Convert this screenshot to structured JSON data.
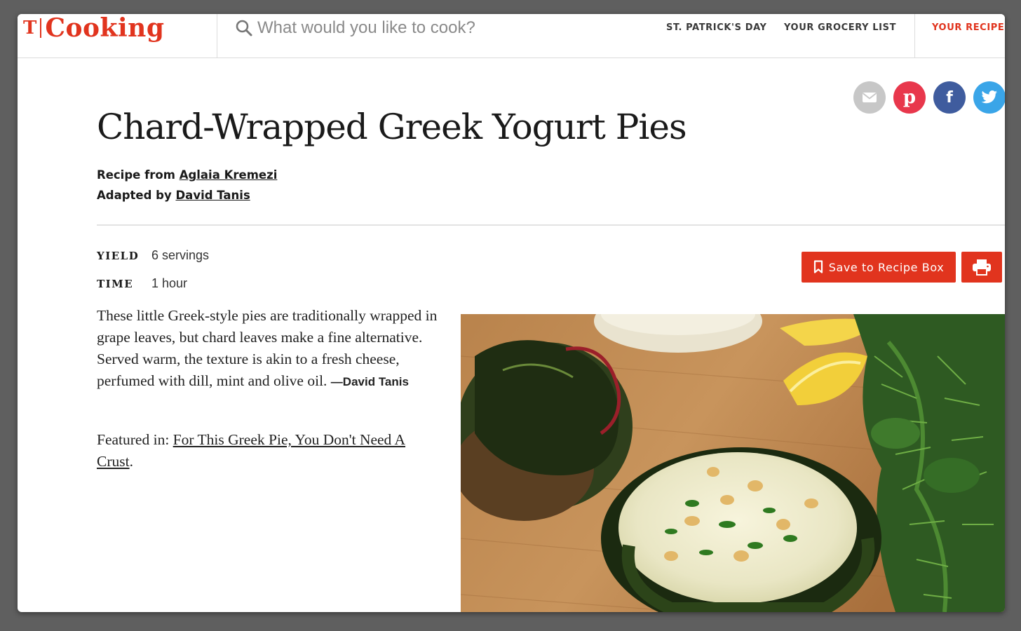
{
  "header": {
    "logo_mark": "T",
    "logo_text": "Cooking",
    "search_placeholder": "What would you like to cook?",
    "nav": [
      "ST. PATRICK'S DAY",
      "YOUR GROCERY LIST",
      "YOUR RECIPE"
    ]
  },
  "share": {
    "email_icon": "envelope-icon",
    "pinterest_icon": "pinterest-icon",
    "pinterest_glyph": "p",
    "facebook_icon": "facebook-icon",
    "facebook_glyph": "f",
    "twitter_icon": "twitter-bird-icon",
    "colors": {
      "email": "#c7c7c7",
      "pinterest": "#e8374c",
      "facebook": "#3f5c9e",
      "twitter": "#3aa5e8"
    }
  },
  "recipe": {
    "title": "Chard-Wrapped Greek Yogurt Pies",
    "recipe_from_label": "Recipe from",
    "recipe_from_name": "Aglaia Kremezi",
    "adapted_by_label": "Adapted by",
    "adapted_by_name": "David Tanis",
    "yield_label": "YIELD",
    "yield_value": "6 servings",
    "time_label": "TIME",
    "time_value": "1 hour",
    "description": "These little Greek-style pies are traditionally wrapped in grape leaves, but chard leaves make a fine alternative. Served warm, the texture is akin to a fresh cheese, perfumed with dill, mint and olive oil.",
    "description_author": "—David Tanis",
    "featured_label": "Featured in:",
    "featured_link": "For This Greek Pie, You Don't Need A Crust",
    "featured_end": "."
  },
  "actions": {
    "save_label": "Save to Recipe Box",
    "save_icon": "bookmark-icon",
    "print_icon": "printer-icon"
  },
  "theme": {
    "accent": "#e1341e"
  }
}
